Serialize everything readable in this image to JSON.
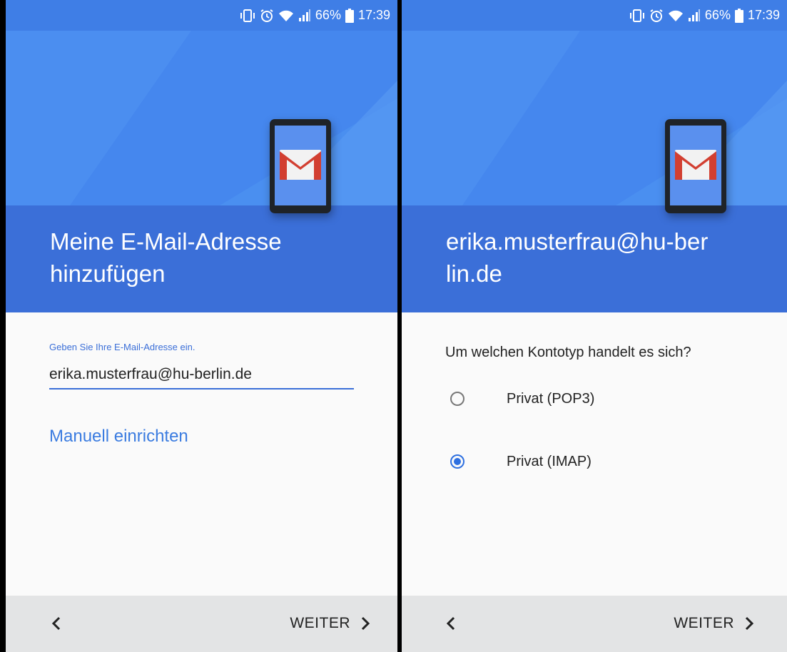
{
  "colors": {
    "accent": "#3b6fd8",
    "status_bar": "#3f7ee6",
    "link": "#3b7ce0",
    "nav_bar": "#e3e4e5"
  },
  "status_bar": {
    "battery": "66%",
    "time": "17:39",
    "icons": [
      "vibrate-icon",
      "alarm-icon",
      "wifi-icon",
      "signal-icon",
      "battery-icon"
    ]
  },
  "left_screen": {
    "title": "Meine E-Mail-Adresse hinzufügen",
    "field_label": "Geben Sie Ihre E-Mail-Adresse ein.",
    "email_value": "erika.musterfrau@hu-berlin.de",
    "manual_link": "Manuell einrichten",
    "next_label": "WEITER"
  },
  "right_screen": {
    "title": "erika.musterfrau@hu-berlin.de",
    "question": "Um welchen Kontotyp handelt es sich?",
    "options": [
      {
        "label": "Privat (POP3)",
        "selected": false
      },
      {
        "label": "Privat (IMAP)",
        "selected": true
      }
    ],
    "next_label": "WEITER"
  }
}
